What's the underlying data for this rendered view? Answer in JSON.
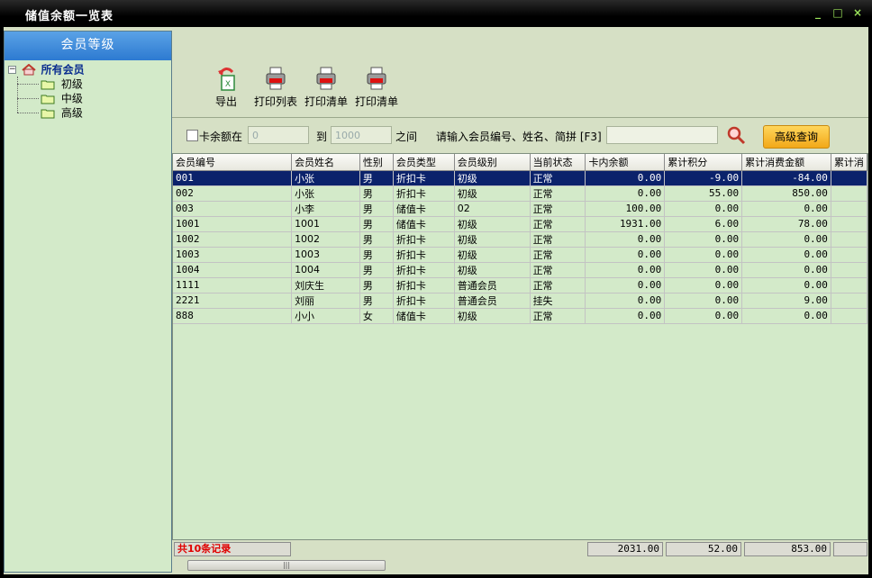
{
  "window": {
    "title": "储值余额一览表"
  },
  "sidebar": {
    "header": "会员等级",
    "root": {
      "label": "所有会员",
      "icon": "house-icon"
    },
    "items": [
      {
        "label": "初级"
      },
      {
        "label": "中级"
      },
      {
        "label": "高级"
      }
    ]
  },
  "toolbar": {
    "export": "导出",
    "print_list": "打印列表",
    "print_detail1": "打印清单",
    "print_detail2": "打印清单"
  },
  "filter": {
    "card_balance_label": "卡余额在",
    "min_value": "0",
    "to_label": "到",
    "max_value": "1000",
    "between_label": "之间",
    "search_prompt": "请输入会员编号、姓名、简拼 [F3]",
    "search_value": "",
    "advanced_button": "高级查询"
  },
  "grid": {
    "columns": [
      "会员编号",
      "会员姓名",
      "性别",
      "会员类型",
      "会员级别",
      "当前状态",
      "卡内余额",
      "累计积分",
      "累计消费金额",
      "累计消"
    ],
    "rows": [
      [
        "001",
        "小张",
        "男",
        "折扣卡",
        "初级",
        "正常",
        "0.00",
        "-9.00",
        "-84.00",
        ""
      ],
      [
        "002",
        "小张",
        "男",
        "折扣卡",
        "初级",
        "正常",
        "0.00",
        "55.00",
        "850.00",
        ""
      ],
      [
        "003",
        "小李",
        "男",
        "储值卡",
        "02",
        "正常",
        "100.00",
        "0.00",
        "0.00",
        ""
      ],
      [
        "1001",
        "1001",
        "男",
        "储值卡",
        "初级",
        "正常",
        "1931.00",
        "6.00",
        "78.00",
        ""
      ],
      [
        "1002",
        "1002",
        "男",
        "折扣卡",
        "初级",
        "正常",
        "0.00",
        "0.00",
        "0.00",
        ""
      ],
      [
        "1003",
        "1003",
        "男",
        "折扣卡",
        "初级",
        "正常",
        "0.00",
        "0.00",
        "0.00",
        ""
      ],
      [
        "1004",
        "1004",
        "男",
        "折扣卡",
        "初级",
        "正常",
        "0.00",
        "0.00",
        "0.00",
        ""
      ],
      [
        "1111",
        "刘庆生",
        "男",
        "折扣卡",
        "普通会员",
        "正常",
        "0.00",
        "0.00",
        "0.00",
        ""
      ],
      [
        "2221",
        "刘丽",
        "男",
        "折扣卡",
        "普通会员",
        "挂失",
        "0.00",
        "0.00",
        "9.00",
        ""
      ],
      [
        "888",
        "小小",
        "女",
        "储值卡",
        "初级",
        "正常",
        "0.00",
        "0.00",
        "0.00",
        ""
      ]
    ]
  },
  "footer": {
    "record_count": "共10条记录",
    "total_balance": "2031.00",
    "total_points": "52.00",
    "total_spent": "853.00"
  },
  "colors": {
    "selection": "#0b226b",
    "accent": "#f2a818",
    "panel": "#d3eac9"
  }
}
